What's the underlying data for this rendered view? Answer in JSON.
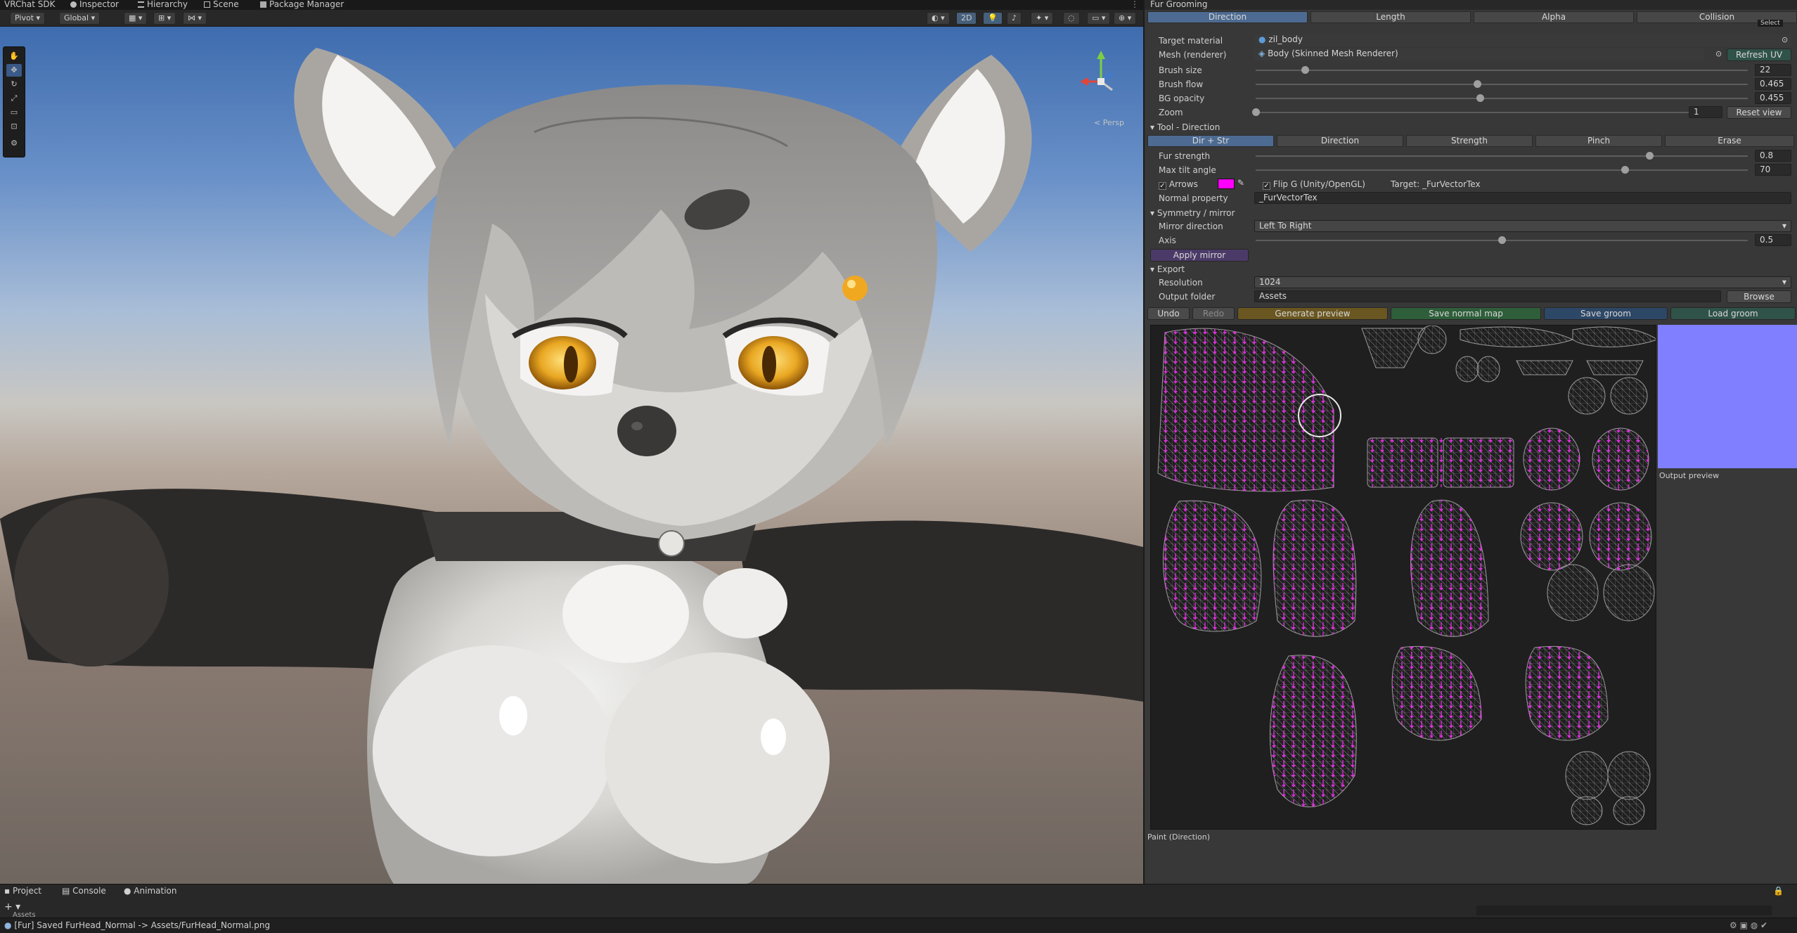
{
  "dock_tabs": [
    {
      "label": "VRChat SDK",
      "icon": "vrchat-icon"
    },
    {
      "label": "Inspector",
      "icon": "info-icon"
    },
    {
      "label": "Hierarchy",
      "icon": "list-icon"
    },
    {
      "label": "Scene",
      "icon": "grid-icon"
    },
    {
      "label": "Package Manager",
      "icon": "package-icon"
    }
  ],
  "scene": {
    "pivot": "Pivot",
    "global": "Global",
    "mode_2d": "2D",
    "persp_label": "< Persp"
  },
  "panel": {
    "title": "Fur Grooming",
    "tabs": [
      "Direction",
      "Length",
      "Alpha",
      "Collision"
    ],
    "active_tab": "Direction",
    "select_label": "Select",
    "target_material_label": "Target material",
    "target_material_value": "zil_body",
    "mesh_label": "Mesh (renderer)",
    "mesh_value": "Body (Skinned Mesh Renderer)",
    "refresh_uv": "Refresh UV",
    "brush_size_label": "Brush size",
    "brush_size_value": "22",
    "brush_size_fraction": 0.1,
    "brush_flow_label": "Brush flow",
    "brush_flow_value": "0.465",
    "brush_flow_fraction": 0.45,
    "bg_opacity_label": "BG opacity",
    "bg_opacity_value": "0.455",
    "bg_opacity_fraction": 0.455,
    "zoom_label": "Zoom",
    "zoom_value": "1",
    "zoom_fraction": 0.0,
    "reset_view": "Reset view",
    "tool_section": "Tool  -  Direction",
    "tool_tabs": [
      "Dir + Str",
      "Direction",
      "Strength",
      "Pinch",
      "Erase"
    ],
    "active_tool_tab": "Dir + Str",
    "fur_strength_label": "Fur strength",
    "fur_strength_value": "0.8",
    "fur_strength_fraction": 0.8,
    "max_tilt_label": "Max tilt angle",
    "max_tilt_value": "70",
    "max_tilt_fraction": 0.75,
    "arrows_label": "Arrows",
    "arrow_color": "#ff00ff",
    "flip_g_label": "Flip G (Unity/OpenGL)",
    "target_label": "Target: _FurVectorTex",
    "normal_property_label": "Normal property",
    "normal_property_value": "_FurVectorTex",
    "symmetry_section": "Symmetry / mirror",
    "mirror_direction_label": "Mirror direction",
    "mirror_direction_value": "Left To Right",
    "axis_label": "Axis",
    "axis_value": "0.5",
    "axis_fraction": 0.5,
    "apply_mirror": "Apply mirror",
    "export_section": "Export",
    "resolution_label": "Resolution",
    "resolution_value": "1024",
    "output_folder_label": "Output folder",
    "output_folder_value": "Assets",
    "browse": "Browse",
    "undo": "Undo",
    "redo": "Redo",
    "generate_preview": "Generate preview",
    "save_normal_map": "Save normal map",
    "save_groom": "Save groom",
    "load_groom": "Load groom",
    "output_preview_label": "Output preview",
    "output_preview_color": "#807fff",
    "paint_label": "Paint  (Direction)"
  },
  "bottom": {
    "tabs": [
      "Project",
      "Console",
      "Animation"
    ],
    "assets_label": "Assets"
  },
  "status": {
    "message": "[Fur] Saved FurHead_Normal -> Assets/FurHead_Normal.png"
  }
}
